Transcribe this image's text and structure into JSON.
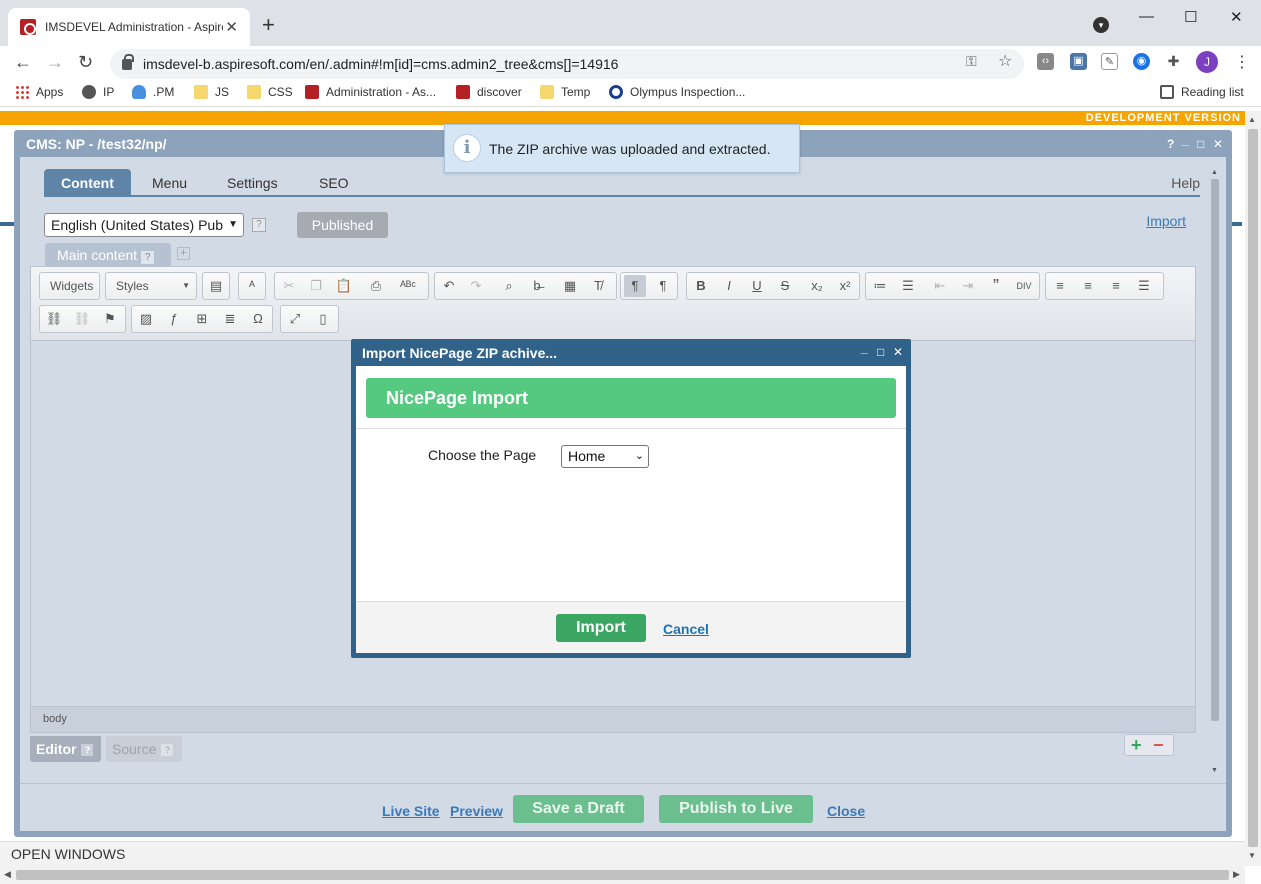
{
  "browser": {
    "tab_title": "IMSDEVEL Administration - Aspire",
    "tab_close": "✕",
    "new_tab": "+",
    "url": "imsdevel-b.aspiresoft.com/en/.admin#!m[id]=cms.admin2_tree&cms[]=14916",
    "profile_initial": "J",
    "bookmarks": [
      "Apps",
      "IP",
      ".PM",
      "JS",
      "CSS",
      "Administration - As...",
      "discover",
      "Temp",
      "Olympus Inspection..."
    ],
    "reading_list": "Reading list"
  },
  "page": {
    "dev_banner": "DEVELOPMENT VERSION",
    "open_windows": "OPEN WINDOWS"
  },
  "notification": {
    "text": "The ZIP archive was uploaded and extracted.",
    "icon": "i"
  },
  "cms": {
    "window_title": "CMS: NP - /test32/np/",
    "controls": [
      "?",
      "_",
      "□",
      "✕"
    ],
    "tabs": [
      "Content",
      "Menu",
      "Settings",
      "SEO"
    ],
    "active_tab": "Content",
    "help": "Help",
    "language_select": "English (United States) Pub",
    "language_help": "?",
    "status_button": "Published",
    "import_link": "Import",
    "content_tab": "Main content",
    "content_tab_help": "?",
    "add_tab": "+",
    "toolbar": {
      "widgets": "Widgets",
      "styles": "Styles"
    },
    "editor_path": "body",
    "mode_tabs": {
      "editor": "Editor",
      "source": "Source",
      "help": "?"
    },
    "add_symbol": "+",
    "remove_symbol": "−",
    "footer": {
      "live_site": "Live Site",
      "preview": "Preview",
      "save_draft": "Save a Draft",
      "publish": "Publish to Live",
      "close": "Close"
    }
  },
  "modal": {
    "title": "Import NicePage ZIP achive...",
    "controls": [
      "_",
      "□",
      "✕"
    ],
    "header": "NicePage Import",
    "page_label": "Choose the Page",
    "page_value": "Home",
    "import_button": "Import",
    "cancel_link": "Cancel"
  },
  "colors": {
    "dev_banner": "#f6a400",
    "window_frame": "#8da2bb",
    "modal_frame": "#30628a",
    "modal_header": "#55c97f",
    "primary_green": "#3aa662",
    "link_blue": "#3b79b8"
  }
}
